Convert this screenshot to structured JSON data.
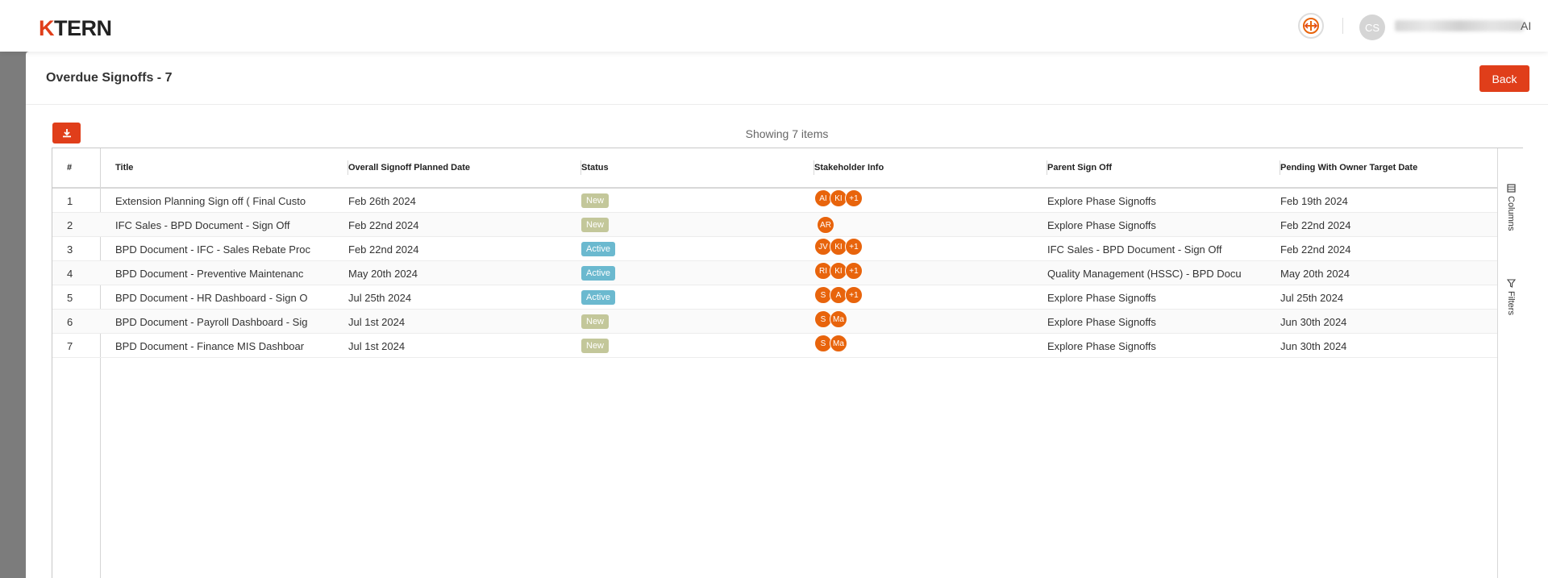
{
  "header": {
    "logo_k": "K",
    "logo_rest": "TERN",
    "user_initials": "CS",
    "user_suffix": "AI"
  },
  "page": {
    "title": "Overdue Signoffs - 7",
    "back_label": "Back",
    "showing_text": "Showing 7 items"
  },
  "table": {
    "columns": [
      "#",
      "Title",
      "Overall Signoff Planned Date",
      "Status",
      "Stakeholder Info",
      "Parent Sign Off",
      "Pending With Owner Target Date"
    ],
    "rows": [
      {
        "num": "1",
        "title": "Extension Planning Sign off ( Final Custo",
        "planned": "Feb 26th 2024",
        "status": "New",
        "stakeholders": [
          "AI",
          "KI",
          "+1"
        ],
        "parent": "Explore Phase Signoffs",
        "pending": "Feb 19th 2024"
      },
      {
        "num": "2",
        "title": "IFC Sales - BPD Document - Sign Off",
        "planned": "Feb 22nd 2024",
        "status": "New",
        "stakeholders": [
          "AR"
        ],
        "parent": "Explore Phase Signoffs",
        "pending": "Feb 22nd 2024"
      },
      {
        "num": "3",
        "title": "BPD Document - IFC - Sales Rebate Proc",
        "planned": "Feb 22nd 2024",
        "status": "Active",
        "stakeholders": [
          "JV",
          "KI",
          "+1"
        ],
        "parent": "IFC Sales - BPD Document - Sign Off",
        "pending": "Feb 22nd 2024"
      },
      {
        "num": "4",
        "title": "BPD Document - Preventive Maintenanc",
        "planned": "May 20th 2024",
        "status": "Active",
        "stakeholders": [
          "RI",
          "KI",
          "+1"
        ],
        "parent": "Quality Management (HSSC) - BPD Docu",
        "pending": "May 20th 2024"
      },
      {
        "num": "5",
        "title": "BPD Document - HR Dashboard - Sign O",
        "planned": "Jul 25th 2024",
        "status": "Active",
        "stakeholders": [
          "S",
          "A",
          "+1"
        ],
        "parent": "Explore Phase Signoffs",
        "pending": "Jul 25th 2024"
      },
      {
        "num": "6",
        "title": "BPD Document - Payroll Dashboard - Sig",
        "planned": "Jul 1st 2024",
        "status": "New",
        "stakeholders": [
          "S",
          "Ma"
        ],
        "parent": "Explore Phase Signoffs",
        "pending": "Jun 30th 2024"
      },
      {
        "num": "7",
        "title": "BPD Document - Finance MIS Dashboar",
        "planned": "Jul 1st 2024",
        "status": "New",
        "stakeholders": [
          "S",
          "Ma"
        ],
        "parent": "Explore Phase Signoffs",
        "pending": "Jun 30th 2024"
      }
    ]
  },
  "side_tools": {
    "columns_label": "Columns",
    "filters_label": "Filters"
  },
  "colors": {
    "brand": "#e03e1a",
    "avatar": "#e8640c",
    "status_new": "#c3c79a",
    "status_active": "#6bb9cf"
  },
  "icons": [
    "download-icon",
    "app-switch-icon",
    "columns-icon",
    "filter-icon"
  ]
}
